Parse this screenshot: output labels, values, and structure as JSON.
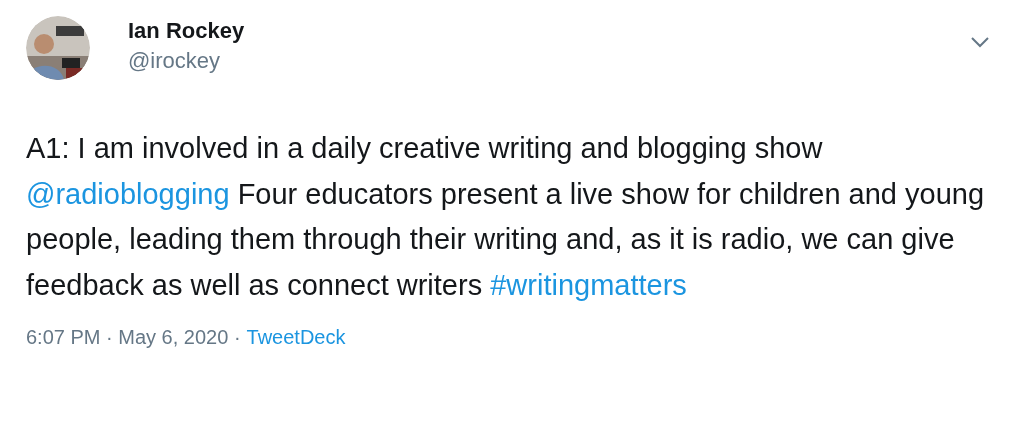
{
  "author": {
    "name": "Ian Rockey",
    "handle": "@irockey"
  },
  "tweet": {
    "parts": [
      {
        "kind": "text",
        "text": "A1: I am involved in a daily creative writing and blogging show "
      },
      {
        "kind": "mention",
        "text": "@radioblogging"
      },
      {
        "kind": "text",
        "text": " Four educators present a live show for children and young people, leading them through their writing and, as it is radio, we can give feedback as well as connect writers "
      },
      {
        "kind": "hashtag",
        "text": "#writingmatters"
      }
    ]
  },
  "footer": {
    "meta": "6:07 PM · May 6, 2020 ·",
    "source": "TweetDeck"
  }
}
